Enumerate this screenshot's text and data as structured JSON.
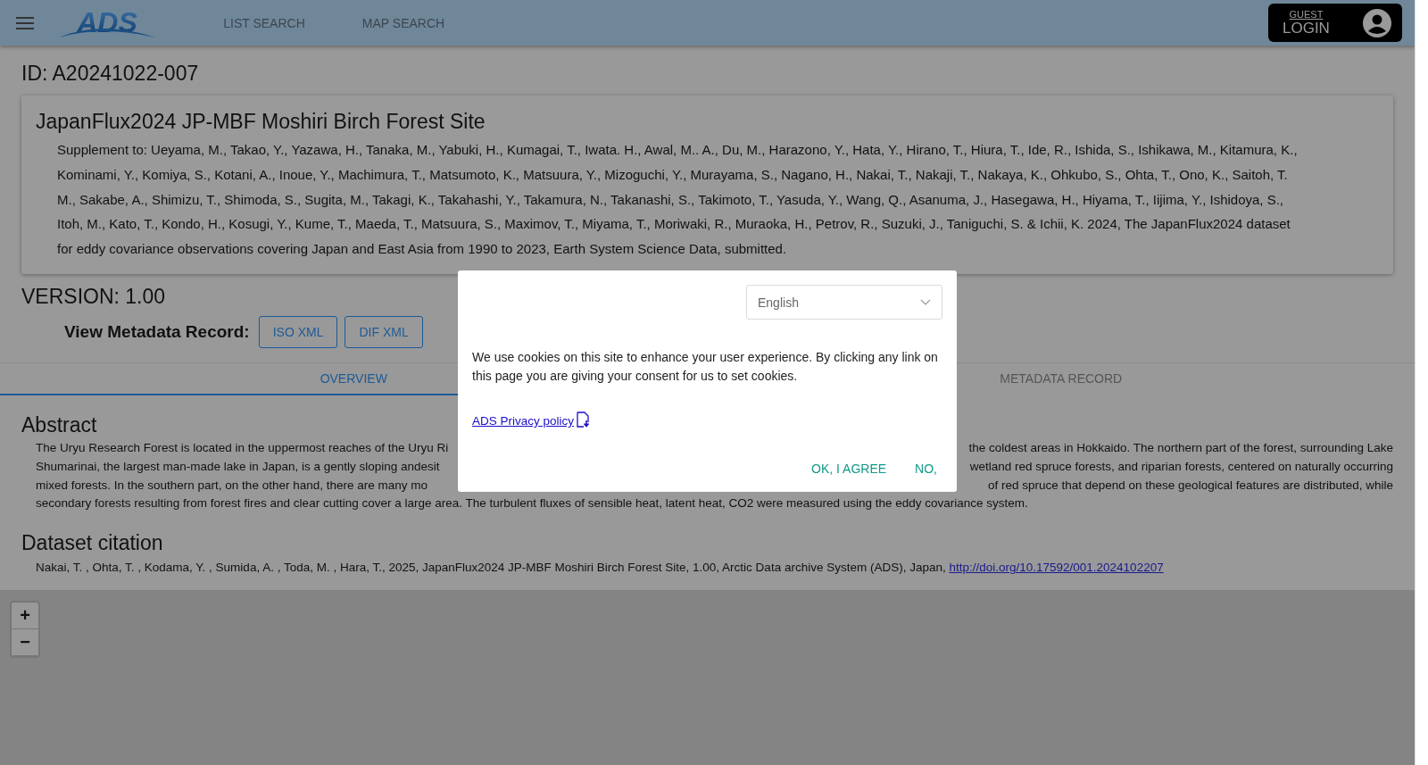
{
  "header": {
    "logo": "ADS",
    "nav": [
      "LIST SEARCH",
      "MAP SEARCH"
    ],
    "account": {
      "user": "GUEST",
      "action": "LOGIN"
    }
  },
  "record_id": "ID: A20241022-007",
  "dataset": {
    "title": "JapanFlux2024 JP-MBF Moshiri Birch Forest Site",
    "supplement": "Supplement to: Ueyama, M., Takao, Y., Yazawa, H., Tanaka, M., Yabuki, H., Kumagai, T., Iwata. H., Awal, M.. A., Du, M., Harazono, Y., Hata, Y., Hirano, T., Hiura, T., Ide, R., Ishida, S., Ishikawa, M., Kitamura, K., Kominami, Y., Komiya, S., Kotani, A., Inoue, Y., Machimura, T., Matsumoto, K., Matsuura, Y., Mizoguchi, Y., Murayama, S., Nagano, H., Nakai, T., Nakaji, T., Nakaya, K., Ohkubo, S., Ohta, T., Ono, K., Saitoh, T. M., Sakabe, A., Shimizu, T., Shimoda, S., Sugita, M., Takagi, K., Takahashi, Y., Takamura, N., Takanashi, S., Takimoto, T., Yasuda, Y., Wang, Q., Asanuma, J., Hasegawa, H., Hiyama, T., Iijima, Y., Ishidoya, S., Itoh, M., Kato, T., Kondo, H., Kosugi, Y., Kume, T., Maeda, T., Matsuura, S., Maximov, T., Miyama, T., Moriwaki, R., Muraoka, H., Petrov, R., Suzuki, J., Taniguchi, S. & Ichii, K. 2024, The JapanFlux2024 dataset for eddy covariance observations covering Japan and East Asia from 1990 to 2023, Earth System Science Data, submitted."
  },
  "version": "VERSION: 1.00",
  "metadata": {
    "label": "View Metadata Record:",
    "buttons": [
      "ISO XML",
      "DIF XML"
    ]
  },
  "tabs": [
    {
      "label": "OVERVIEW",
      "selected": true
    },
    {
      "label": "METADATA RECORD",
      "selected": false
    }
  ],
  "abstract": {
    "heading": "Abstract",
    "lines": [
      {
        "left": "The Uryu Research Forest is located in the uppermost reaches of the Uryu Ri",
        "right": "the coldest areas in Hokkaido. The northern part of the forest, surrounding Lake"
      },
      {
        "left": "Shumarinai, the largest man-made lake in Japan, is a gently sloping andesit",
        "right": "wetland red spruce forests, and riparian forests, centered on naturally occurring"
      },
      {
        "left": "mixed forests. In the southern part, on the other hand, there are many mo",
        "right": "of red spruce that depend on these geological features are distributed, while"
      },
      {
        "left": "secondary forests resulting from forest fires and clear cutting cover a large area.  The turbulent fluxes of sensible heat, latent heat, CO2 were measured using the eddy covariance system."
      }
    ]
  },
  "citation": {
    "heading": "Dataset citation",
    "text": "Nakai, T. , Ohta, T. , Kodama, Y. , Sumida, A. , Toda, M. , Hara, T., 2025, JapanFlux2024 JP-MBF Moshiri Birch Forest Site, 1.00, Arctic Data archive System (ADS), Japan, ",
    "link": "http://doi.org/10.17592/001.2024102207"
  },
  "map": {
    "zoom_in": "+",
    "zoom_out": "−"
  },
  "cookie_dialog": {
    "language": "English",
    "message": "We use cookies on this site to enhance your user experience. By clicking any link on this page you are giving your consent for us to set cookies.",
    "privacy_link": "ADS Privacy policy",
    "buttons": [
      "OK, I AGREE",
      "NO,"
    ]
  }
}
